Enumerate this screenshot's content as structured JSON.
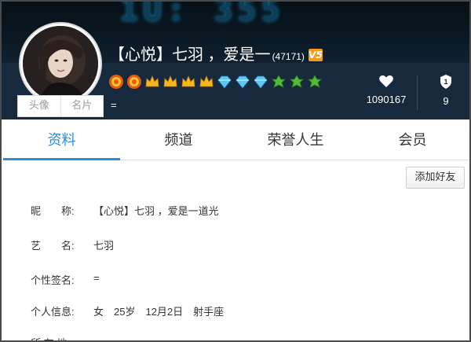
{
  "header": {
    "user_title": "【心悦】七羽 ，爱是一",
    "user_id": "(47171)",
    "v_badge": "V5",
    "signature": "=",
    "avatar_tabs": [
      "头像",
      "名片"
    ],
    "badges": [
      "medal-icon",
      "medal-icon",
      "crown-icon",
      "crown-icon",
      "crown-icon",
      "crown-icon",
      "diamond-icon",
      "diamond-icon",
      "diamond-icon",
      "green-crown-icon",
      "green-crown-icon",
      "green-crown-icon"
    ],
    "likes_count": "1090167",
    "level_value": "9"
  },
  "nav": {
    "tabs": [
      "资料",
      "频道",
      "荣誉人生",
      "会员"
    ],
    "active_index": 0
  },
  "profile": {
    "add_friend_label": "添加好友",
    "rows": [
      {
        "label": "昵　　称:",
        "value": "【心悦】七羽 ，爱是一道光"
      },
      {
        "label": "艺　　名:",
        "value": "七羽"
      },
      {
        "label": "个性签名:",
        "value": "="
      },
      {
        "label": "个人信息:",
        "value": "女　25岁　12月2日　射手座"
      },
      {
        "label": "所 在 地:",
        "value": ""
      }
    ]
  },
  "colors": {
    "accent": "#2e8bd6",
    "header_bg": "#16293d",
    "v_badge": "#f39a1c"
  }
}
